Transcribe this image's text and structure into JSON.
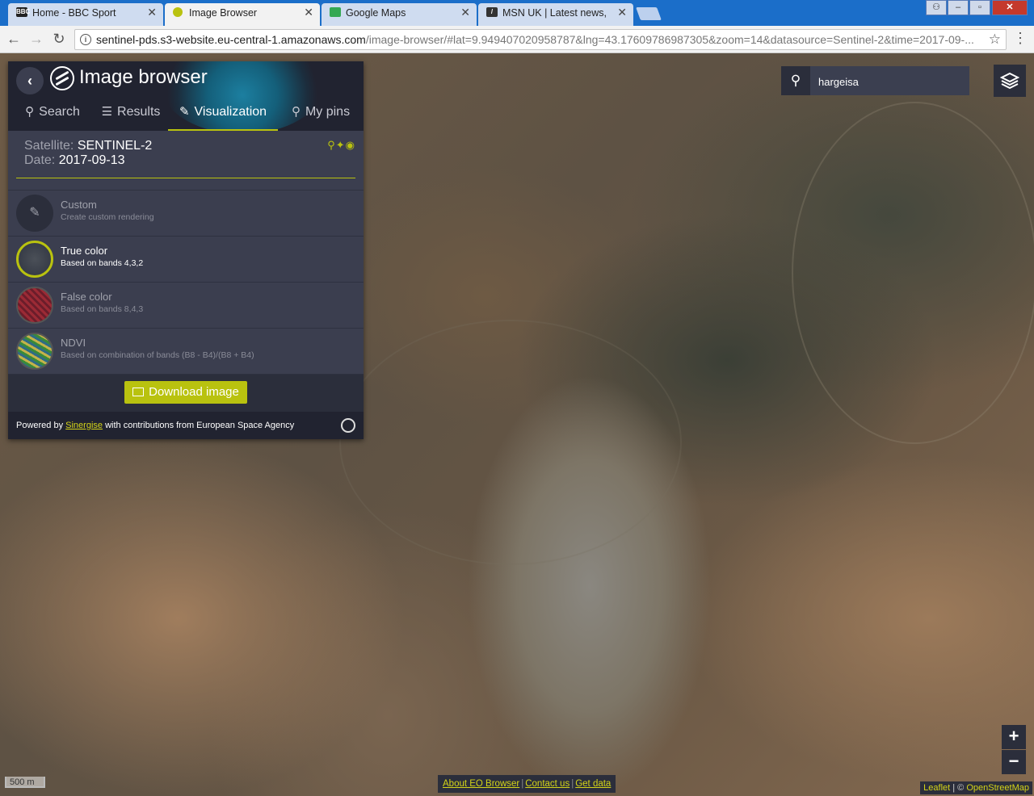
{
  "browser": {
    "tabs": [
      {
        "title": "Home - BBC Sport",
        "favicon": "bbc-icon"
      },
      {
        "title": "Image Browser",
        "favicon": "sentinel-icon"
      },
      {
        "title": "Google Maps",
        "favicon": "maps-icon"
      },
      {
        "title": "MSN UK | Latest news, H",
        "favicon": "msn-icon"
      }
    ],
    "url_host": "sentinel-pds.s3-website.eu-central-1.amazonaws.com",
    "url_path": "/image-browser/#lat=9.949407020958787&lng=43.17609786987305&zoom=14&datasource=Sentinel-2&time=2017-09-..."
  },
  "panel": {
    "title": "Image browser",
    "tabs": [
      {
        "label": "Search",
        "icon": "search-icon"
      },
      {
        "label": "Results",
        "icon": "sliders-icon"
      },
      {
        "label": "Visualization",
        "icon": "brush-icon"
      },
      {
        "label": "My pins",
        "icon": "pin-icon"
      }
    ],
    "satellite_label": "Satellite:",
    "satellite_value": "SENTINEL-2",
    "date_label": "Date:",
    "date_value": "2017-09-13",
    "visualizations": [
      {
        "name": "Custom",
        "desc": "Create custom rendering"
      },
      {
        "name": "True color",
        "desc": "Based on bands 4,3,2"
      },
      {
        "name": "False color",
        "desc": "Based on bands 8,4,3"
      },
      {
        "name": "NDVI",
        "desc": "Based on combination of bands (B8 - B4)/(B8 + B4)"
      }
    ],
    "download_label": "Download image",
    "powered_prefix": "Powered by",
    "powered_link": "Sinergise",
    "powered_suffix": "with contributions from European Space Agency"
  },
  "map": {
    "search_value": "hargeisa",
    "zoom_in": "+",
    "zoom_out": "−",
    "scale_label": "500 m",
    "links": [
      "About EO Browser",
      "Contact us",
      "Get data"
    ],
    "attribution_leaflet": "Leaflet",
    "attribution_sep": "| ©",
    "attribution_osm": "OpenStreetMap"
  },
  "colors": {
    "accent": "#b9c20f",
    "panel": "#3b3e4f",
    "tabstrip": "#1b6ec9"
  }
}
